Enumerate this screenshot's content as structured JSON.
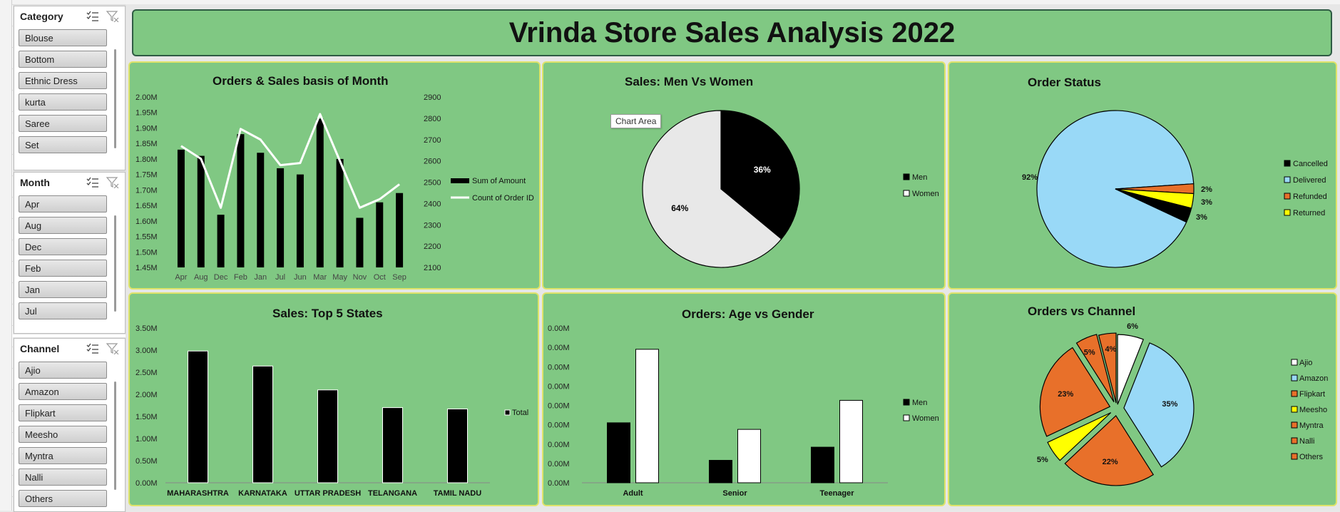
{
  "title": "Vrinda Store Sales Analysis 2022",
  "colors": {
    "panel": "#80c883",
    "men": "#000000",
    "women": "#ffffff",
    "delivered": "#99d9f7",
    "orange": "#e8702a",
    "yellow": "#ffff00"
  },
  "slicers": [
    {
      "name": "Category",
      "items": [
        "Blouse",
        "Bottom",
        "Ethnic Dress",
        "kurta",
        "Saree",
        "Set"
      ]
    },
    {
      "name": "Month",
      "items": [
        "Apr",
        "Aug",
        "Dec",
        "Feb",
        "Jan",
        "Jul"
      ]
    },
    {
      "name": "Channel",
      "items": [
        "Ajio",
        "Amazon",
        "Flipkart",
        "Meesho",
        "Myntra",
        "Nalli",
        "Others"
      ]
    }
  ],
  "charts": {
    "month": {
      "title": "Orders & Sales basis of Month",
      "legend": [
        "Sum of Amount",
        "Count of Order ID"
      ],
      "chart_data": {
        "type": "bar",
        "categories": [
          "Apr",
          "Aug",
          "Dec",
          "Feb",
          "Jan",
          "Jul",
          "Jun",
          "Mar",
          "May",
          "Nov",
          "Oct",
          "Sep"
        ],
        "series": [
          {
            "name": "Sum of Amount",
            "values": [
              1.83,
              1.81,
              1.62,
              1.88,
              1.82,
              1.77,
              1.75,
              1.93,
              1.8,
              1.61,
              1.66,
              1.69
            ]
          },
          {
            "name": "Count of Order ID",
            "values": [
              2670,
              2610,
              2380,
              2750,
              2700,
              2580,
              2590,
              2820,
              2600,
              2380,
              2420,
              2490
            ]
          }
        ],
        "ylim": [
          1.45,
          2.0
        ],
        "y2lim": [
          2100,
          2900
        ],
        "yticks": [
          "1.45M",
          "1.50M",
          "1.55M",
          "1.60M",
          "1.65M",
          "1.70M",
          "1.75M",
          "1.80M",
          "1.85M",
          "1.90M",
          "1.95M",
          "2.00M"
        ],
        "y2ticks": [
          "2100",
          "2200",
          "2300",
          "2400",
          "2500",
          "2600",
          "2700",
          "2800",
          "2900"
        ]
      }
    },
    "gender": {
      "title": "Sales: Men Vs Women",
      "tooltip": "Chart Area",
      "legend": [
        "Men",
        "Women"
      ],
      "chart_data": {
        "type": "pie",
        "labels": [
          "Men",
          "Women"
        ],
        "values": [
          36,
          64
        ],
        "value_labels": [
          "36%",
          "64%"
        ]
      }
    },
    "status": {
      "title": "Order Status",
      "legend": [
        "Cancelled",
        "Delivered",
        "Refunded",
        "Returned"
      ],
      "chart_data": {
        "type": "pie",
        "labels": [
          "Cancelled",
          "Delivered",
          "Refunded",
          "Returned"
        ],
        "values": [
          3,
          92,
          2,
          3
        ],
        "value_labels": [
          "3%",
          "92%",
          "2%",
          "3%"
        ]
      }
    },
    "states": {
      "title": "Sales: Top 5 States",
      "legend": [
        "Total"
      ],
      "chart_data": {
        "type": "bar",
        "categories": [
          "MAHARASHTRA",
          "KARNATAKA",
          "UTTAR PRADESH",
          "TELANGANA",
          "TAMIL NADU"
        ],
        "values": [
          2.98,
          2.64,
          2.1,
          1.7,
          1.67
        ],
        "ylim": [
          0,
          3.5
        ],
        "yticks": [
          "0.00M",
          "0.50M",
          "1.00M",
          "1.50M",
          "2.00M",
          "2.50M",
          "3.00M",
          "3.50M"
        ]
      }
    },
    "age": {
      "title": "Orders: Age vs Gender",
      "legend": [
        "Men",
        "Women"
      ],
      "chart_data": {
        "type": "bar",
        "categories": [
          "Adult",
          "Senior",
          "Teenager"
        ],
        "series": [
          {
            "name": "Men",
            "values": [
              1.55e-05,
              5.8e-06,
              9.2e-06
            ]
          },
          {
            "name": "Women",
            "values": [
              3.45e-05,
              1.38e-05,
              2.13e-05
            ]
          }
        ],
        "ylim": [
          0,
          4e-05
        ],
        "yticks": [
          "0.00M",
          "0.00M",
          "0.00M",
          "0.00M",
          "0.00M",
          "0.00M",
          "0.00M",
          "0.00M",
          "0.00M"
        ]
      }
    },
    "channel": {
      "title": "Orders vs Channel",
      "legend": [
        "Ajio",
        "Amazon",
        "Flipkart",
        "Meesho",
        "Myntra",
        "Nalli",
        "Others"
      ],
      "chart_data": {
        "type": "pie",
        "labels": [
          "Ajio",
          "Amazon",
          "Flipkart",
          "Meesho",
          "Myntra",
          "Nalli",
          "Others"
        ],
        "values": [
          6,
          35,
          22,
          5,
          23,
          5,
          4
        ],
        "value_labels": [
          "6%",
          "35%",
          "22%",
          "5%",
          "23%",
          "5%",
          "4%"
        ]
      }
    }
  }
}
